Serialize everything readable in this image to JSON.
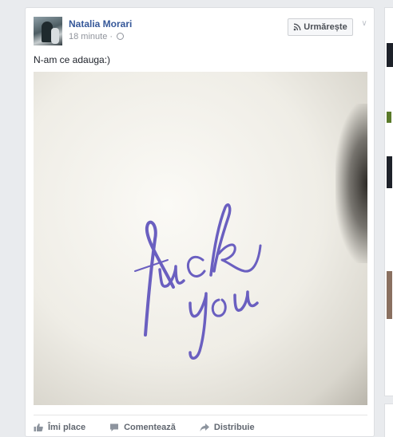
{
  "post": {
    "author": "Natalia Morari",
    "time": "18 minute · ",
    "follow_label": "Urmărește",
    "text": "N-am ce adauga:)"
  },
  "actions": {
    "like": "Îmi place",
    "comment": "Comentează",
    "share": "Distribuie"
  },
  "colors": {
    "link_blue": "#365899",
    "background": "#e9ebee",
    "ink_purple": "#6a5fc0"
  }
}
